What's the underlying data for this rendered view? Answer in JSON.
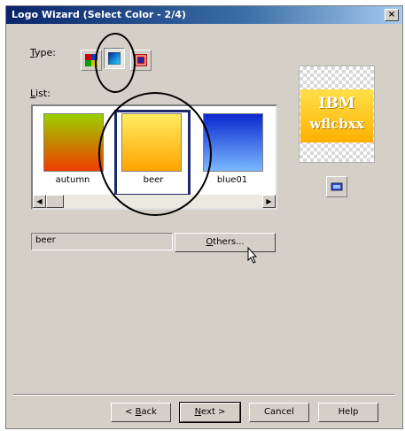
{
  "window": {
    "title": "Logo Wizard (Select Color - 2/4)",
    "close_label": "×"
  },
  "type_section": {
    "label_mnemonic": "T",
    "label_rest": "ype:",
    "buttons": [
      {
        "icon": "multicolor-type-icon"
      },
      {
        "icon": "gradient-type-icon"
      },
      {
        "icon": "texture-type-icon"
      }
    ]
  },
  "list_section": {
    "label_mnemonic": "L",
    "label_rest": "ist:",
    "items": [
      {
        "label": "autumn",
        "colors": [
          "#9ad000",
          "#f03c00"
        ]
      },
      {
        "label": "beer",
        "colors": [
          "#ffec60",
          "#ffa400"
        ]
      },
      {
        "label": "blue01",
        "colors": [
          "#0a28d0",
          "#7ab8ff"
        ]
      }
    ],
    "selected": "beer"
  },
  "scrollbar": {
    "left_arrow": "◀",
    "right_arrow": "▶"
  },
  "selected_field": {
    "value": "beer"
  },
  "others_button": {
    "label_mnemonic": "O",
    "label_rest": "thers..."
  },
  "preview": {
    "line1": "IBM",
    "line2": "wflcbxx"
  },
  "preview_button": {
    "icon": "preview-options-icon"
  },
  "footer": {
    "back": {
      "prefix": "< ",
      "mnemonic": "B",
      "rest": "ack"
    },
    "next": {
      "mnemonic": "N",
      "rest": "ext >"
    },
    "cancel": "Cancel",
    "help": "Help"
  },
  "colors": {
    "titlebar": "#0a246a",
    "dialog": "#d4d0c8",
    "selection": "#1c2a6c"
  }
}
